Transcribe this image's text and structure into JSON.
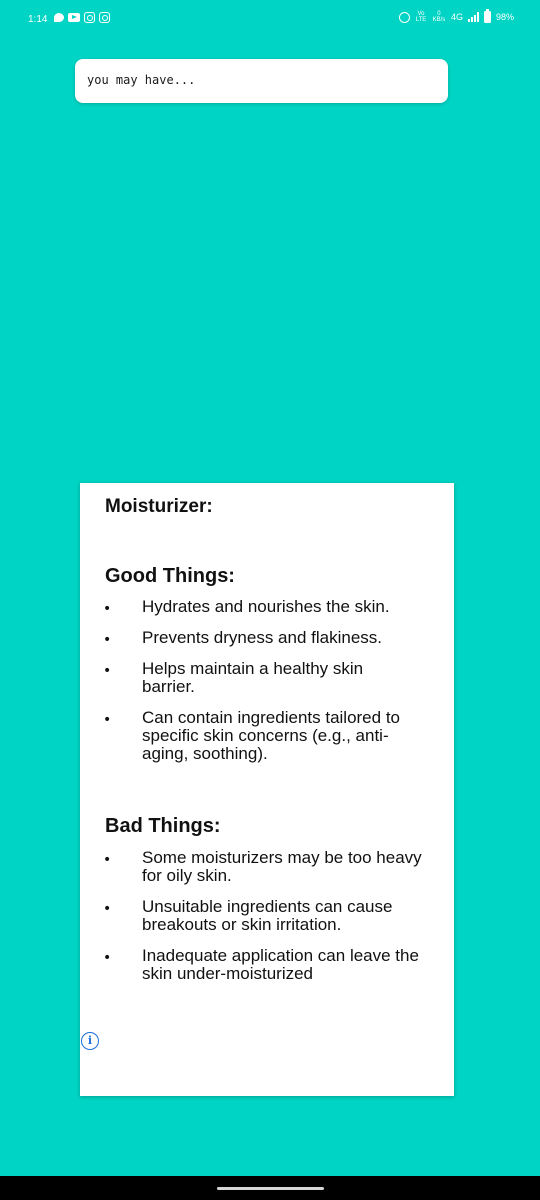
{
  "status_bar": {
    "time": "1:14",
    "notification_icons": [
      "chat-bubble-icon",
      "youtube-icon",
      "instagram-icon",
      "instagram-icon"
    ],
    "volte": "Vo LTE",
    "net_speed": "0 KB/s",
    "network_type": "4G",
    "battery": "98%"
  },
  "search": {
    "query": "you may have..."
  },
  "card": {
    "title": "Moisturizer:",
    "good": {
      "heading": "Good Things:",
      "items": [
        "Hydrates and nourishes the skin.",
        "Prevents dryness and flakiness.",
        "Helps maintain a healthy skin barrier.",
        "Can contain ingredients tailored to specific skin concerns (e.g., anti-aging, soothing)."
      ]
    },
    "bad": {
      "heading": "Bad Things:",
      "items": [
        "Some moisturizers may be too heavy for oily skin.",
        "Unsuitable ingredients can cause breakouts or skin irritation.",
        "Inadequate application can leave the skin under-moisturized"
      ]
    },
    "bullet": "•"
  },
  "info_icon_glyph": "i",
  "colors": {
    "background": "#00d4c4",
    "card": "#ffffff",
    "info_icon": "#1a6fdb"
  }
}
